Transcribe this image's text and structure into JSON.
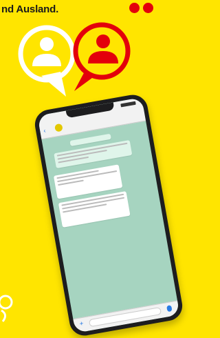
{
  "headline": "nd Ausland.",
  "icons": {
    "white_bubble": "person-speech-bubble-icon",
    "red_bubble": "person-speech-bubble-icon",
    "decor": "umlaut-dots-icon"
  },
  "colors": {
    "background": "#ffe500",
    "accent_red": "#e3000b",
    "chat_background": "#a6d4c0"
  }
}
